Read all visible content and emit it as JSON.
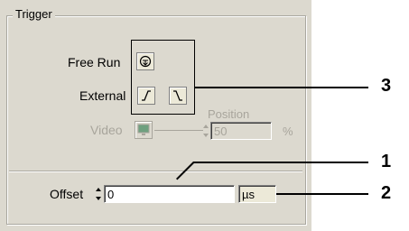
{
  "trigger": {
    "title": "Trigger",
    "free_run_label": "Free Run",
    "external_label": "External",
    "video_label": "Video",
    "position_label": "Position",
    "position_value": "50",
    "position_unit": "%",
    "offset_label": "Offset",
    "offset_value": "0",
    "unit_value": "µs"
  },
  "callouts": {
    "c1": "1",
    "c2": "2",
    "c3": "3"
  }
}
